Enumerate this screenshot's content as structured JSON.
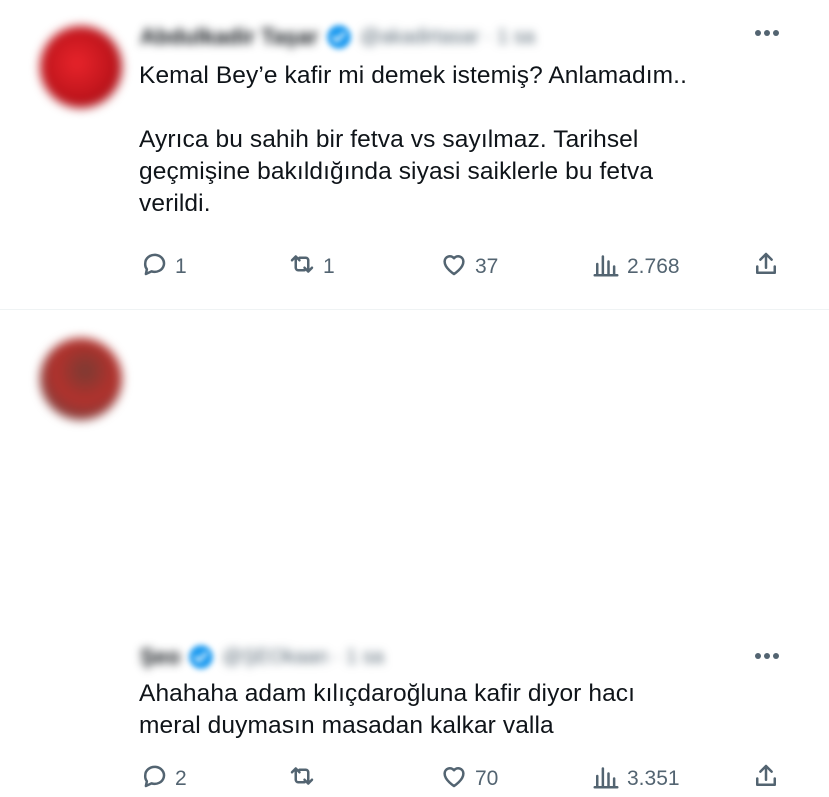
{
  "tweets": [
    {
      "author_name": "Abdulkadir Taşar",
      "author_handle": "@akadirtasar · 1 sa",
      "text": "Kemal Bey’e kafir mi demek istemiş? Anlamadım..\n\nAyrıca bu sahih bir fetva vs sayılmaz. Tarihsel\ngeçmişine bakıldığında siyasi saiklerle bu fetva\nverildi.",
      "replies": "1",
      "retweets": "1",
      "likes": "37",
      "views": "2.768"
    },
    {
      "author_name": "Şeo",
      "author_handle": "@ŞEOkaan · 1 sa",
      "text": "Ahahaha adam kılıçdaroğluna kafir diyor hacı\nmeral duymasın masadan kalkar valla",
      "replies": "2",
      "retweets": "",
      "likes": "70",
      "views": "3.351"
    }
  ],
  "icons": {
    "reply": "reply-icon",
    "retweet": "retweet-icon",
    "like": "heart-icon",
    "views": "views-icon",
    "share": "share-icon",
    "more": "more-icon",
    "verified": "verified-badge-icon"
  },
  "colors": {
    "text": "#0f1419",
    "secondary": "#536471",
    "verified": "#1d9bf0",
    "divider": "#eff3f4"
  }
}
